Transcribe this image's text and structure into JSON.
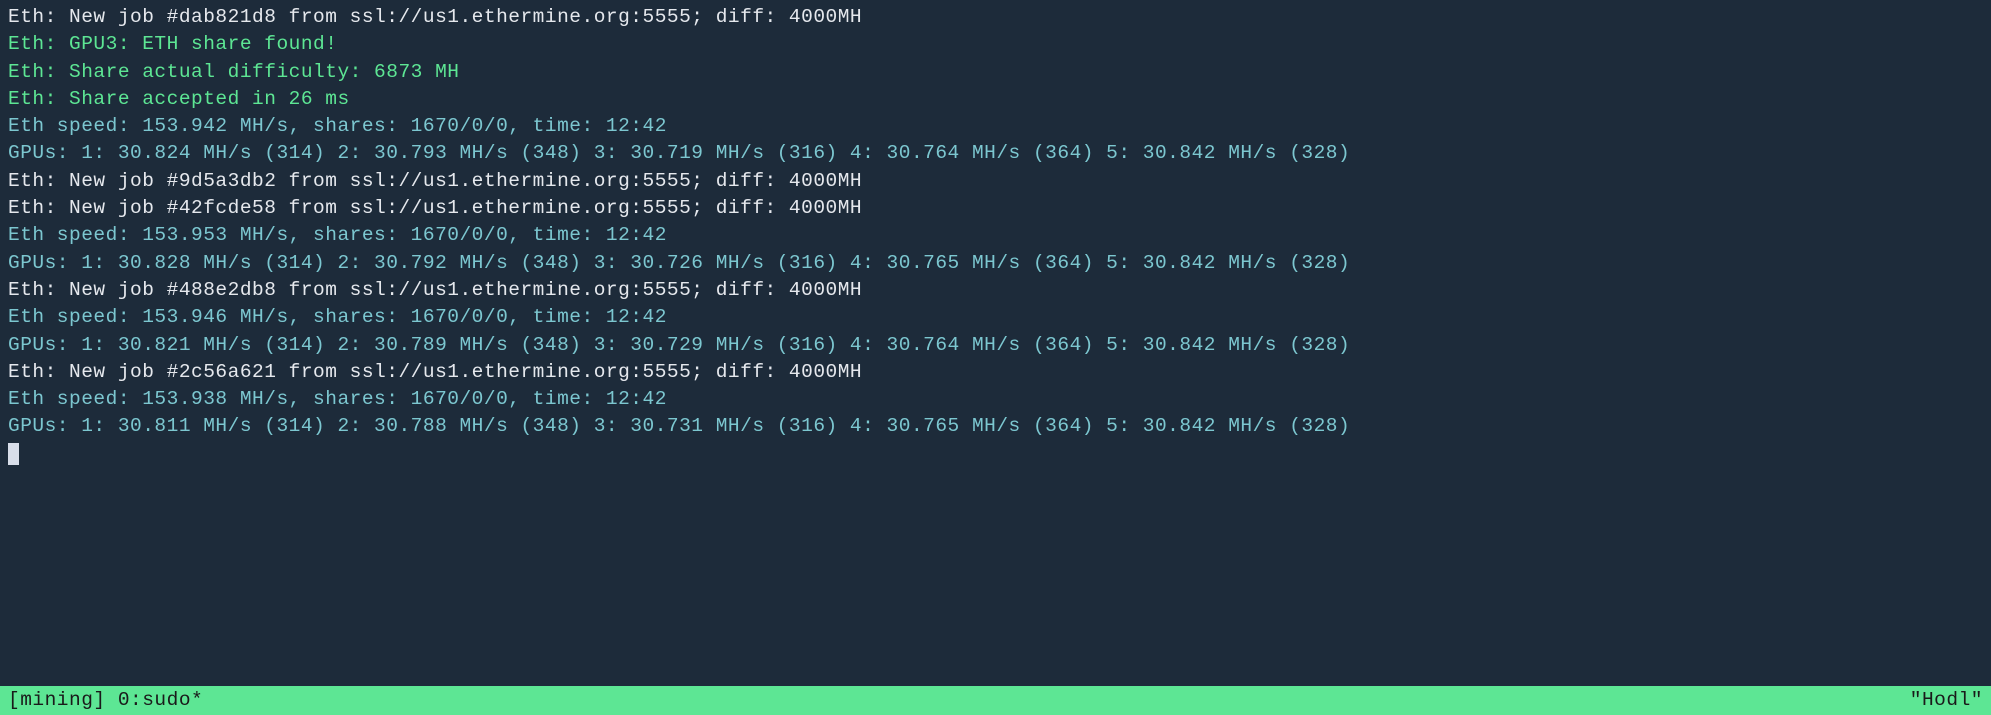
{
  "lines": [
    {
      "cls": "white",
      "text": "Eth: New job #dab821d8 from ssl://us1.ethermine.org:5555; diff: 4000MH"
    },
    {
      "cls": "green",
      "text": "Eth: GPU3: ETH share found!"
    },
    {
      "cls": "green",
      "text": "Eth: Share actual difficulty: 6873 MH"
    },
    {
      "cls": "green",
      "text": "Eth: Share accepted in 26 ms"
    },
    {
      "cls": "cyan",
      "text": "Eth speed: 153.942 MH/s, shares: 1670/0/0, time: 12:42"
    },
    {
      "cls": "cyan",
      "text": "GPUs: 1: 30.824 MH/s (314) 2: 30.793 MH/s (348) 3: 30.719 MH/s (316) 4: 30.764 MH/s (364) 5: 30.842 MH/s (328)"
    },
    {
      "cls": "white",
      "text": "Eth: New job #9d5a3db2 from ssl://us1.ethermine.org:5555; diff: 4000MH"
    },
    {
      "cls": "white",
      "text": "Eth: New job #42fcde58 from ssl://us1.ethermine.org:5555; diff: 4000MH"
    },
    {
      "cls": "cyan",
      "text": "Eth speed: 153.953 MH/s, shares: 1670/0/0, time: 12:42"
    },
    {
      "cls": "cyan",
      "text": "GPUs: 1: 30.828 MH/s (314) 2: 30.792 MH/s (348) 3: 30.726 MH/s (316) 4: 30.765 MH/s (364) 5: 30.842 MH/s (328)"
    },
    {
      "cls": "white",
      "text": "Eth: New job #488e2db8 from ssl://us1.ethermine.org:5555; diff: 4000MH"
    },
    {
      "cls": "cyan",
      "text": "Eth speed: 153.946 MH/s, shares: 1670/0/0, time: 12:42"
    },
    {
      "cls": "cyan",
      "text": "GPUs: 1: 30.821 MH/s (314) 2: 30.789 MH/s (348) 3: 30.729 MH/s (316) 4: 30.764 MH/s (364) 5: 30.842 MH/s (328)"
    },
    {
      "cls": "white",
      "text": "Eth: New job #2c56a621 from ssl://us1.ethermine.org:5555; diff: 4000MH"
    },
    {
      "cls": "cyan",
      "text": "Eth speed: 153.938 MH/s, shares: 1670/0/0, time: 12:42"
    },
    {
      "cls": "cyan",
      "text": "GPUs: 1: 30.811 MH/s (314) 2: 30.788 MH/s (348) 3: 30.731 MH/s (316) 4: 30.765 MH/s (364) 5: 30.842 MH/s (328)"
    }
  ],
  "statusbar": {
    "left": "[mining] 0:sudo*",
    "right": "\"Hodl\""
  }
}
